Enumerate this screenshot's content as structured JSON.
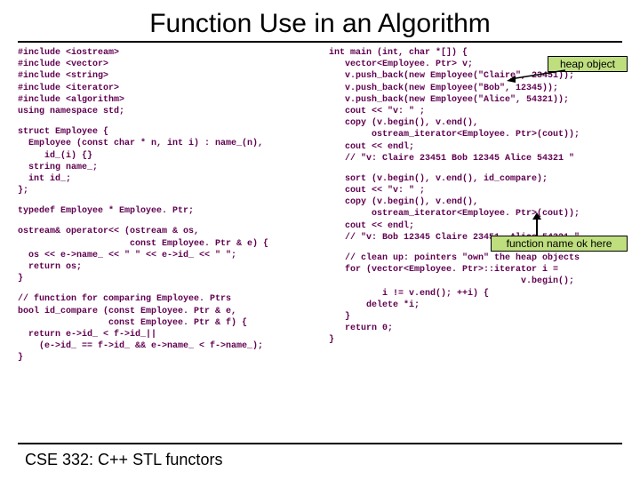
{
  "title": "Function Use in an Algorithm",
  "left": {
    "b1": "#include <iostream>\n#include <vector>\n#include <string>\n#include <iterator>\n#include <algorithm>\nusing namespace std;",
    "b2": "struct Employee {\n  Employee (const char * n, int i) : name_(n),\n     id_(i) {}\n  string name_;\n  int id_;\n};",
    "b3": "typedef Employee * Employee. Ptr;",
    "b4": "ostream& operator<< (ostream & os,\n                     const Employee. Ptr & e) {\n  os << e->name_ << \" \" << e->id_ << \" \";\n  return os;\n}",
    "b5": "// function for comparing Employee. Ptrs\nbool id_compare (const Employee. Ptr & e,\n                 const Employee. Ptr & f) {\n  return e->id_ < f->id_||\n    (e->id_ == f->id_ && e->name_ < f->name_);\n}"
  },
  "right": {
    "b1": "int main (int, char *[]) {\n   vector<Employee. Ptr> v;\n   v.push_back(new Employee(\"Claire\", 23451));\n   v.push_back(new Employee(\"Bob\", 12345));\n   v.push_back(new Employee(\"Alice\", 54321));\n   cout << \"v: \" ;\n   copy (v.begin(), v.end(),\n        ostream_iterator<Employee. Ptr>(cout));\n   cout << endl;\n   // \"v: Claire 23451 Bob 12345 Alice 54321 \"",
    "b2": "   sort (v.begin(), v.end(), id_compare);\n   cout << \"v: \" ;\n   copy (v.begin(), v.end(),\n        ostream_iterator<Employee. Ptr>(cout));\n   cout << endl;\n   // \"v: Bob 12345 Claire 23451  Alice 54321 \"",
    "b3": "   // clean up: pointers \"own\" the heap objects\n   for (vector<Employee. Ptr>::iterator i =\n                                    v.begin();\n          i != v.end(); ++i) {\n       delete *i;\n   }\n   return 0;\n}"
  },
  "callouts": {
    "heap": "heap object",
    "funcname": "function name ok here"
  },
  "footer": "CSE 332: C++ STL functors"
}
